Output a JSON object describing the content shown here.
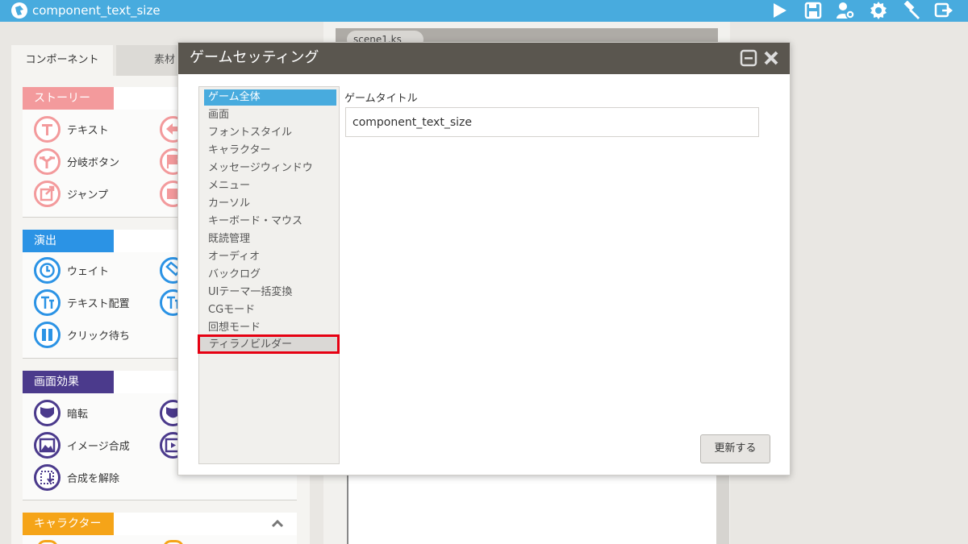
{
  "app": {
    "title": "component_text_size"
  },
  "toolbar": {
    "icons": [
      "play-icon",
      "save-icon",
      "user-settings-icon",
      "gear-icon",
      "hammer-icon",
      "export-icon"
    ]
  },
  "left_panel": {
    "tabs": [
      {
        "label": "コンポーネント",
        "active": true
      },
      {
        "label": "素材",
        "active": false
      }
    ],
    "groups": [
      {
        "label": "ストーリー",
        "color": "#f39a9c",
        "items": [
          {
            "label": "テキスト",
            "icon": "text-t-icon"
          },
          {
            "label": "",
            "icon": "back-arrow-icon"
          },
          {
            "label": "分岐ボタン",
            "icon": "branch-icon"
          },
          {
            "label": "",
            "icon": "flag-icon"
          },
          {
            "label": "ジャンプ",
            "icon": "jump-icon"
          },
          {
            "label": "",
            "icon": "window-icon"
          }
        ]
      },
      {
        "label": "演出",
        "color": "#2b93e5",
        "items": [
          {
            "label": "ウェイト",
            "icon": "clock-icon"
          },
          {
            "label": "",
            "icon": "erase-icon"
          },
          {
            "label": "テキスト配置",
            "icon": "text-layout-icon"
          },
          {
            "label": "",
            "icon": "text-layout-icon-2"
          },
          {
            "label": "クリック待ち",
            "icon": "pause-icon"
          }
        ]
      },
      {
        "label": "画面効果",
        "color": "#4b3a8c",
        "items": [
          {
            "label": "暗転",
            "icon": "shield-fade-icon"
          },
          {
            "label": "",
            "icon": "shield-fade-icon-2"
          },
          {
            "label": "イメージ合成",
            "icon": "image-compose-icon"
          },
          {
            "label": "",
            "icon": "movie-icon"
          },
          {
            "label": "合成を解除",
            "icon": "uncompose-icon"
          }
        ]
      },
      {
        "label": "キャラクター",
        "color": "#f5a418",
        "items": []
      }
    ]
  },
  "scenario": {
    "tab_label": "scene1.ks"
  },
  "dialog": {
    "title": "ゲームセッティング",
    "menu": [
      "ゲーム全体",
      "画面",
      "フォントスタイル",
      "キャラクター",
      "メッセージウィンドウ",
      "メニュー",
      "カーソル",
      "キーボード・マウス",
      "既読管理",
      "オーディオ",
      "バックログ",
      "UIテーマ一括変換",
      "CGモード",
      "回想モード",
      "ティラノビルダー"
    ],
    "selected_index": 0,
    "highlighted_index": 14,
    "field": {
      "label": "ゲームタイトル",
      "value": "component_text_size"
    },
    "update_button": "更新する"
  },
  "colors": {
    "topbar": "#48abde",
    "dialog_header": "#5a564f",
    "highlight_border": "#e60012"
  }
}
